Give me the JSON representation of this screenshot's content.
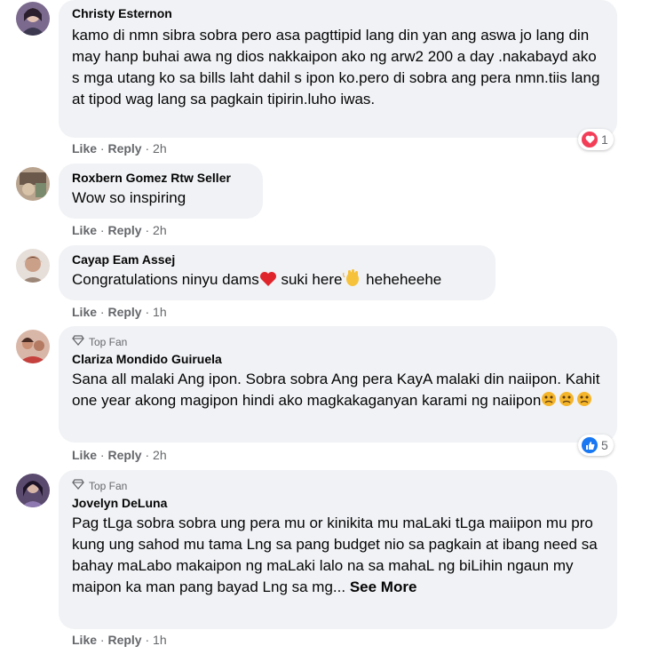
{
  "comments": [
    {
      "name": "Christy Esternon",
      "text": "kamo di nmn sibra sobra pero asa pagttipid lang din yan ang aswa jo lang din may hanp buhai awa ng dios nakkaipon ako ng arw2 200 a day .nakabayd ako s mga utang ko sa bills laht dahil s ipon ko.pero di sobra ang pera nmn.tiis lang at tipod wag lang sa pagkain tipirin.luho iwas.",
      "like": "Like",
      "reply": "Reply",
      "time": "2h",
      "reaction": {
        "icon": "love-reaction-icon",
        "count": "1"
      }
    },
    {
      "name": "Roxbern Gomez Rtw Seller",
      "text": "Wow so inspiring",
      "like": "Like",
      "reply": "Reply",
      "time": "2h"
    },
    {
      "name": "Cayap Eam Assej",
      "text_before_heart": "Congratulations ninyu dams",
      "text_middle": " suki here",
      "text_after": " heheheehe",
      "like": "Like",
      "reply": "Reply",
      "time": "1h"
    },
    {
      "badge": "Top Fan",
      "name": "Clariza Mondido Guiruela",
      "text": "Sana all malaki Ang ipon. Sobra sobra Ang pera KayA malaki din naiipon. Kahit one year akong magipon hindi ako magkakaganyan karami ng naiipon",
      "like": "Like",
      "reply": "Reply",
      "time": "2h",
      "reaction": {
        "icon": "like-reaction-icon",
        "count": "5"
      }
    },
    {
      "badge": "Top Fan",
      "name": "Jovelyn DeLuna",
      "text": "Pag tLga sobra sobra ung pera mu or kinikita mu maLaki tLga maiipon mu pro kung ung sahod mu tama Lng sa pang budget nio sa pagkain at ibang need sa bahay maLabo makaipon ng maLaki lalo na sa mahaL ng biLihin ngaun my maipon ka man pang bayad Lng sa mg...",
      "see_more": "See More",
      "like": "Like",
      "reply": "Reply",
      "time": "1h"
    }
  ],
  "colors": {
    "bubble": "#f0f2f5",
    "love": "#f33e58",
    "like": "#1877f2",
    "meta": "#65676b"
  }
}
